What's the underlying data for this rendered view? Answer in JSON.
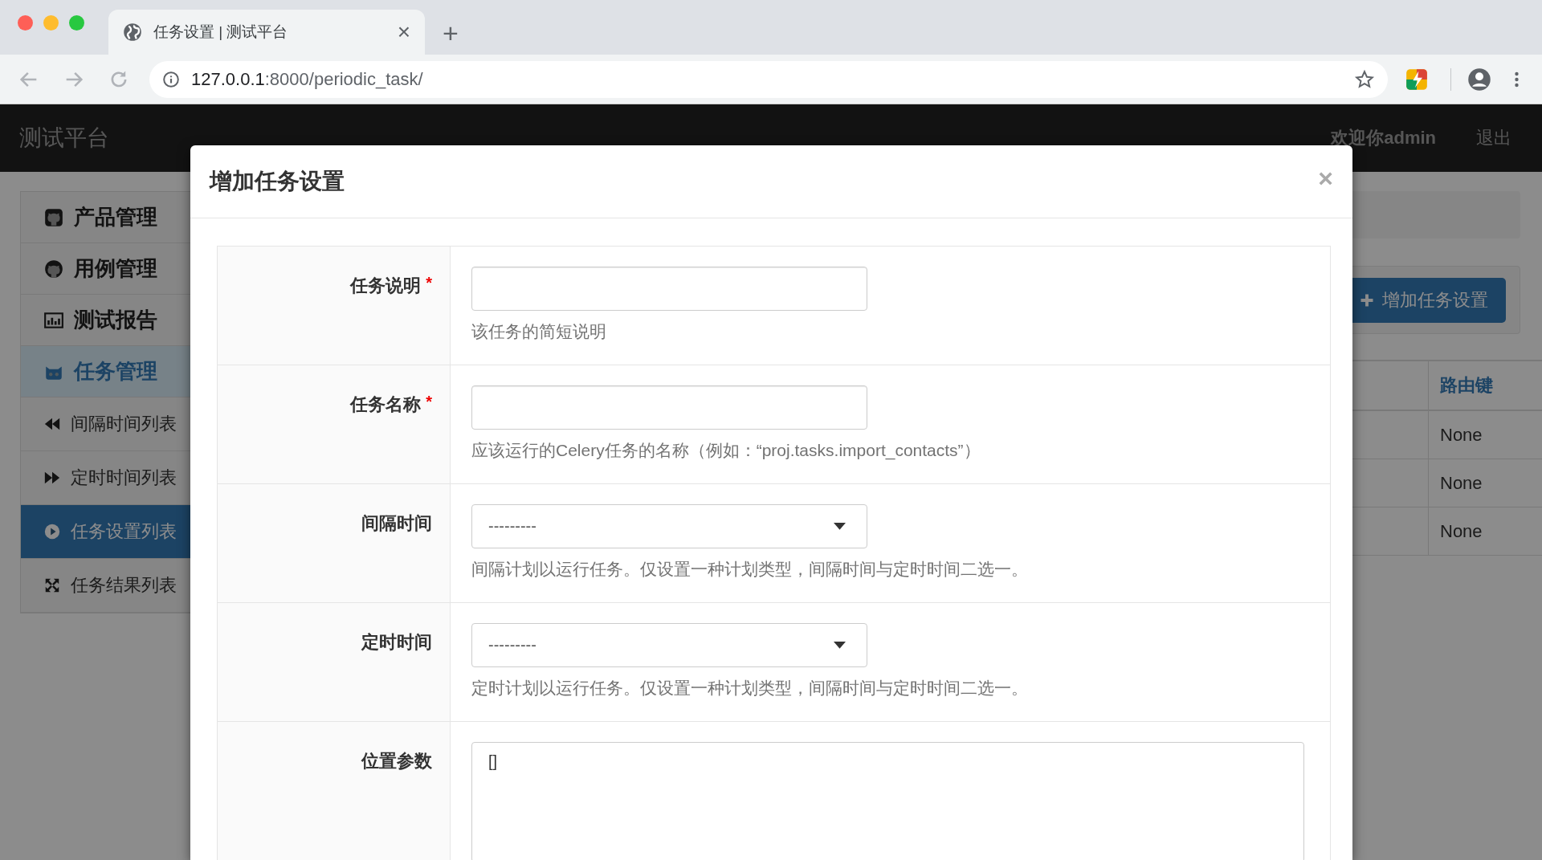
{
  "browser": {
    "tab_title": "任务设置 | 测试平台",
    "tab_close": "×",
    "new_tab": "+",
    "url_host": "127.0.0.1",
    "url_rest": ":8000/periodic_task/"
  },
  "navbar": {
    "brand": "测试平台",
    "welcome": "欢迎你admin",
    "logout": "退出"
  },
  "sidebar": {
    "items": [
      {
        "label": "产品管理",
        "expanded": false
      },
      {
        "label": "用例管理",
        "expanded": false
      },
      {
        "label": "测试报告",
        "expanded": false
      },
      {
        "label": "任务管理",
        "expanded": true,
        "children": [
          {
            "label": "间隔时间列表",
            "selected": false
          },
          {
            "label": "定时时间列表",
            "selected": false
          },
          {
            "label": "任务设置列表",
            "selected": true
          },
          {
            "label": "任务结果列表",
            "selected": false
          }
        ]
      }
    ]
  },
  "main": {
    "add_button": "增加任务设置",
    "table": {
      "columns": [
        "路由键"
      ],
      "rows": [
        [
          "None"
        ],
        [
          "None"
        ],
        [
          "None"
        ]
      ]
    }
  },
  "modal": {
    "title": "增加任务设置",
    "close": "×",
    "fields": [
      {
        "kind": "text",
        "label": "任务说明",
        "required_mark": "*",
        "help": "该任务的简短说明"
      },
      {
        "kind": "text",
        "label": "任务名称",
        "required_mark": "*",
        "help": "应该运行的Celery任务的名称（例如：“proj.tasks.import_contacts”）"
      },
      {
        "kind": "select",
        "label": "间隔时间",
        "value": "---------",
        "help": "间隔计划以运行任务。仅设置一种计划类型，间隔时间与定时时间二选一。"
      },
      {
        "kind": "select",
        "label": "定时时间",
        "value": "---------",
        "help": "定时计划以运行任务。仅设置一种计划类型，间隔时间与定时时间二选一。"
      },
      {
        "kind": "textarea",
        "label": "位置参数",
        "value": "[]"
      }
    ]
  }
}
